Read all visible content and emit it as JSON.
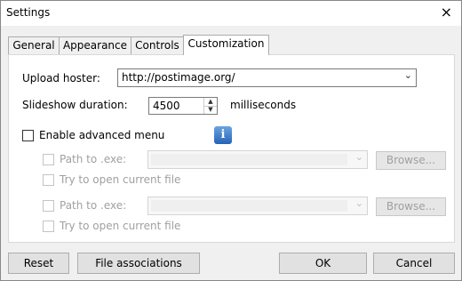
{
  "window": {
    "title": "Settings",
    "close_glyph": "×"
  },
  "tabs": [
    {
      "label": "General"
    },
    {
      "label": "Appearance"
    },
    {
      "label": "Controls"
    },
    {
      "label": "Customization"
    }
  ],
  "upload": {
    "label": "Upload hoster:",
    "value": "http://postimage.org/"
  },
  "slideshow": {
    "label": "Slideshow duration:",
    "value": "4500",
    "unit": "milliseconds"
  },
  "advanced": {
    "label": "Enable advanced menu",
    "checked": false,
    "info_icon": "info-icon"
  },
  "entries": [
    {
      "path_label": "Path to .exe:",
      "browse_label": "Browse...",
      "try_label": "Try to open current file"
    },
    {
      "path_label": "Path to .exe:",
      "browse_label": "Browse...",
      "try_label": "Try to open current file"
    }
  ],
  "buttons": {
    "reset": "Reset",
    "file_assoc": "File associations",
    "ok": "OK",
    "cancel": "Cancel"
  }
}
